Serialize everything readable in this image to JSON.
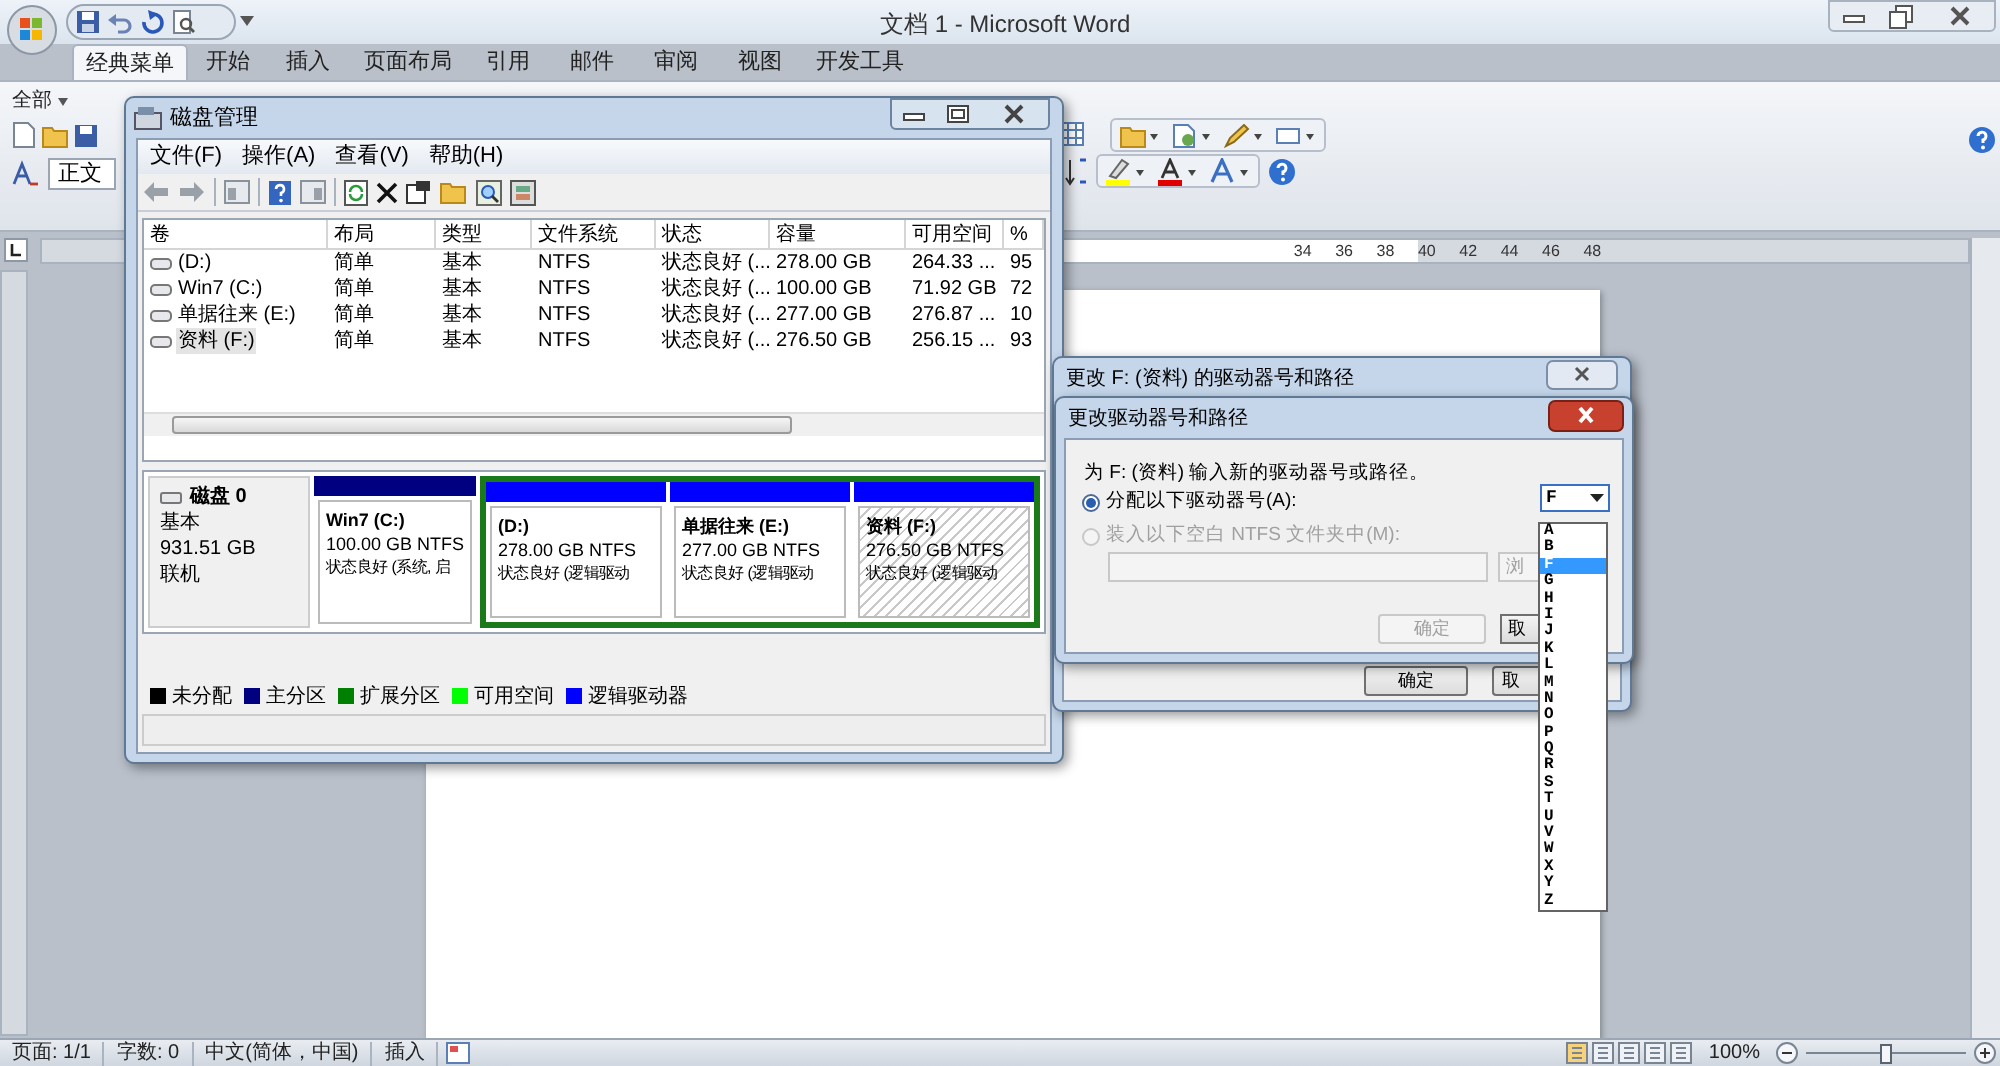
{
  "word": {
    "title": "文档 1 - Microsoft Word",
    "tabs": [
      {
        "label": "经典菜单",
        "selected": true
      },
      {
        "label": "开始",
        "selected": false
      },
      {
        "label": "插入",
        "selected": false
      },
      {
        "label": "页面布局",
        "selected": false
      },
      {
        "label": "引用",
        "selected": false
      },
      {
        "label": "邮件",
        "selected": false
      },
      {
        "label": "审阅",
        "selected": false
      },
      {
        "label": "视图",
        "selected": false
      },
      {
        "label": "开发工具",
        "selected": false
      }
    ],
    "menu_button": "全部",
    "style_box": "正文",
    "ruler_numbers": [
      "34",
      "36",
      "38",
      "40",
      "42",
      "44",
      "46",
      "48"
    ]
  },
  "disk_management": {
    "title": "磁盘管理",
    "menu": [
      "文件(F)",
      "操作(A)",
      "查看(V)",
      "帮助(H)"
    ],
    "columns": [
      "卷",
      "布局",
      "类型",
      "文件系统",
      "状态",
      "容量",
      "可用空间",
      "%"
    ],
    "rows": [
      {
        "cells": [
          "(D:)",
          "简单",
          "基本",
          "NTFS",
          "状态良好 (...",
          "278.00 GB",
          "264.33 ...",
          "95"
        ],
        "selected": false
      },
      {
        "cells": [
          "Win7 (C:)",
          "简单",
          "基本",
          "NTFS",
          "状态良好 (...",
          "100.00 GB",
          "71.92 GB",
          "72"
        ],
        "selected": false
      },
      {
        "cells": [
          "单据往来 (E:)",
          "简单",
          "基本",
          "NTFS",
          "状态良好 (...",
          "277.00 GB",
          "276.87 ...",
          "10"
        ],
        "selected": false
      },
      {
        "cells": [
          "资料 (F:)",
          "简单",
          "基本",
          "NTFS",
          "状态良好 (...",
          "276.50 GB",
          "256.15 ...",
          "93"
        ],
        "selected": true
      }
    ],
    "disk": {
      "name": "磁盘 0",
      "type": "基本",
      "size": "931.51 GB",
      "state": "联机"
    },
    "partitions": [
      {
        "kind": "primary",
        "name": "Win7  (C:)",
        "size": "100.00 GB NTFS",
        "status": "状态良好 (系统, 启",
        "selected": false
      },
      {
        "kind": "logical",
        "name": "(D:)",
        "size": "278.00 GB NTFS",
        "status": "状态良好 (逻辑驱动",
        "selected": false
      },
      {
        "kind": "logical",
        "name": "单据往来  (E:)",
        "size": "277.00 GB NTFS",
        "status": "状态良好 (逻辑驱动",
        "selected": false
      },
      {
        "kind": "logical",
        "name": "资料  (F:)",
        "size": "276.50 GB NTFS",
        "status": "状态良好 (逻辑驱动",
        "selected": true
      }
    ],
    "legend": [
      {
        "label": "未分配",
        "color": "#000000"
      },
      {
        "label": "主分区",
        "color": "#000080"
      },
      {
        "label": "扩展分区",
        "color": "#008000"
      },
      {
        "label": "可用空间",
        "color": "#00ff00"
      },
      {
        "label": "逻辑驱动器",
        "color": "#0000ff"
      }
    ]
  },
  "dialog_back": {
    "title": "更改 F: (资料) 的驱动器号和路径",
    "buttons": [
      "确定",
      "取"
    ]
  },
  "dialog_front": {
    "title": "更改驱动器号和路径",
    "prompt": "为 F: (资料) 输入新的驱动器号或路径。",
    "options": [
      {
        "label": "分配以下驱动器号(A):",
        "selected": true,
        "disabled": false
      },
      {
        "label": "装入以下空白 NTFS 文件夹中(M):",
        "selected": false,
        "disabled": true
      }
    ],
    "drive_value": "F",
    "browse_button": "浏",
    "ok_button": "确定",
    "cancel_button": "取",
    "letters": [
      {
        "label": "A",
        "selected": false
      },
      {
        "label": "B",
        "selected": false
      },
      {
        "label": "F",
        "selected": true
      },
      {
        "label": "G",
        "selected": false
      },
      {
        "label": "H",
        "selected": false
      },
      {
        "label": "I",
        "selected": false
      },
      {
        "label": "J",
        "selected": false
      },
      {
        "label": "K",
        "selected": false
      },
      {
        "label": "L",
        "selected": false
      },
      {
        "label": "M",
        "selected": false
      },
      {
        "label": "N",
        "selected": false
      },
      {
        "label": "O",
        "selected": false
      },
      {
        "label": "P",
        "selected": false
      },
      {
        "label": "Q",
        "selected": false
      },
      {
        "label": "R",
        "selected": false
      },
      {
        "label": "S",
        "selected": false
      },
      {
        "label": "T",
        "selected": false
      },
      {
        "label": "U",
        "selected": false
      },
      {
        "label": "V",
        "selected": false
      },
      {
        "label": "W",
        "selected": false
      },
      {
        "label": "X",
        "selected": false
      },
      {
        "label": "Y",
        "selected": false
      },
      {
        "label": "Z",
        "selected": false
      }
    ]
  },
  "status_bar": {
    "items": [
      "页面: 1/1",
      "字数: 0",
      "中文(简体，中国)",
      "插入"
    ],
    "zoom": "100%",
    "zoom_level": {
      "level": 0.5
    }
  }
}
